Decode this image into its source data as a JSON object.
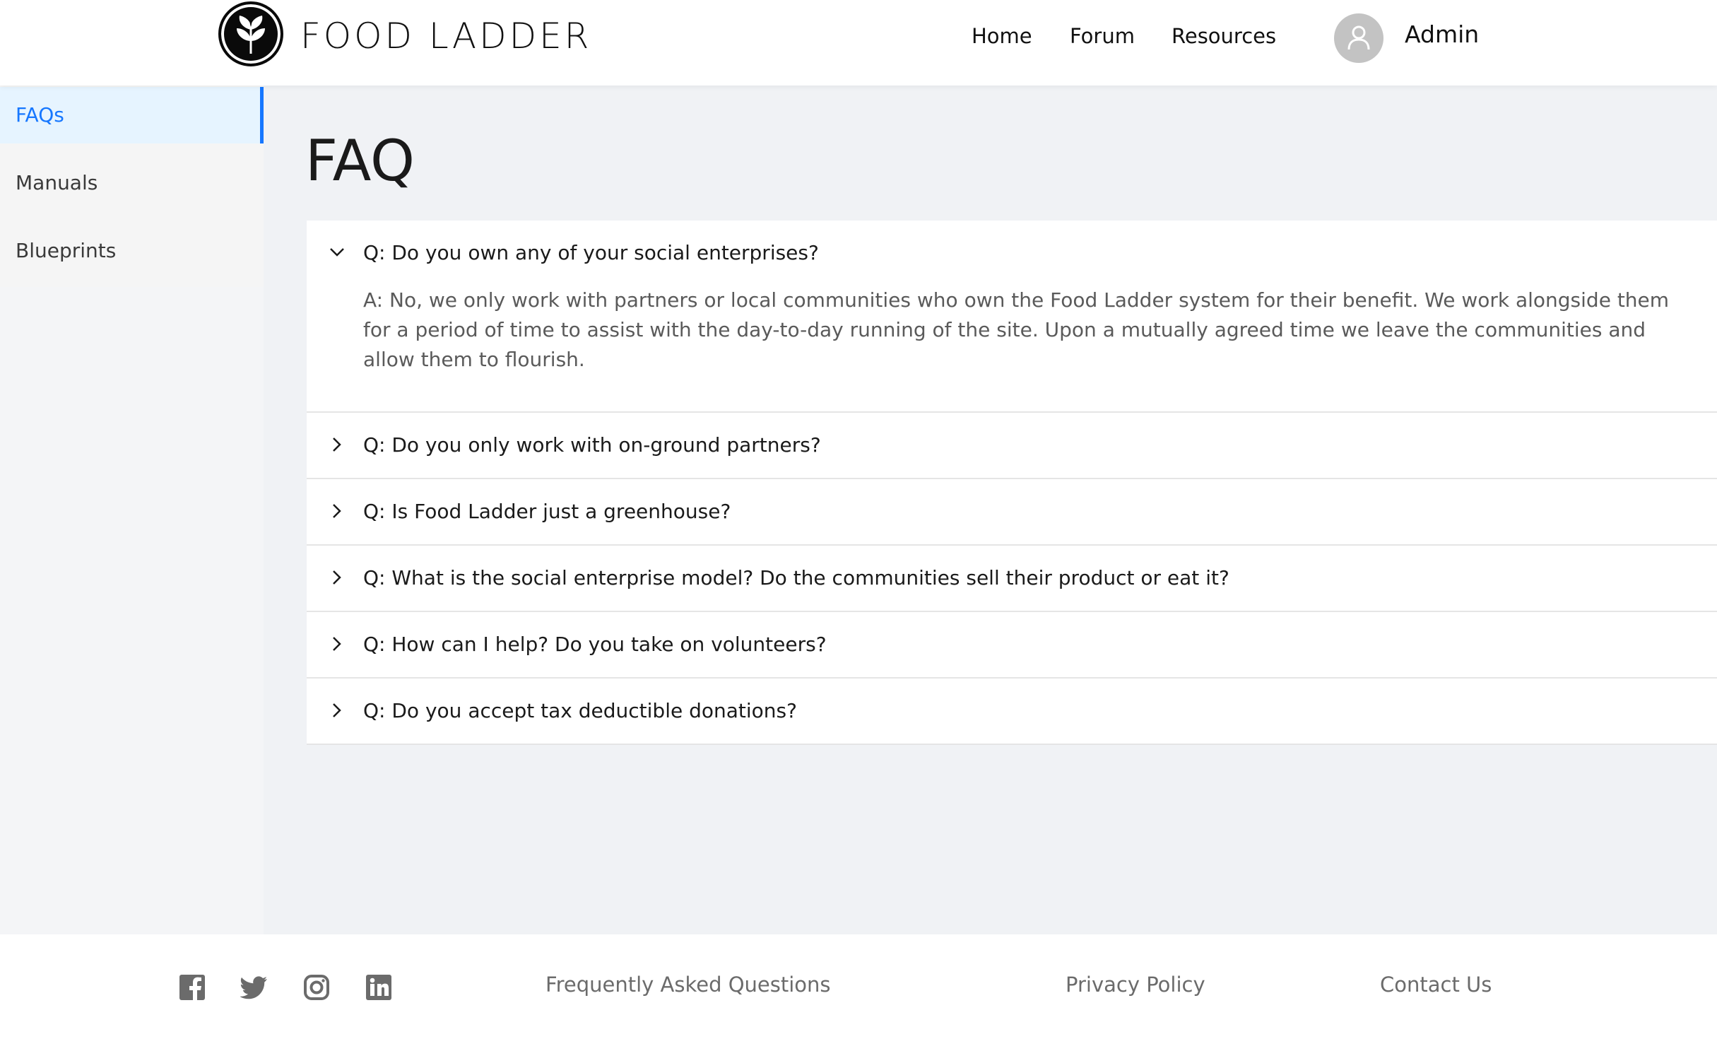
{
  "header": {
    "logo_text": "FOOD LADDER",
    "nav": [
      {
        "label": "Home"
      },
      {
        "label": "Forum"
      },
      {
        "label": "Resources"
      }
    ],
    "user_name": "Admin"
  },
  "sidebar": {
    "items": [
      {
        "label": "FAQs",
        "active": true
      },
      {
        "label": "Manuals"
      },
      {
        "label": "Blueprints"
      }
    ]
  },
  "main": {
    "title": "FAQ",
    "faqs": [
      {
        "question": "Q: Do you own any of your social enterprises?",
        "answer": "A: No, we only work with partners or local communities who own the Food Ladder system for their benefit. We work alongside them for a period of time to assist with the day-to-day running of the site. Upon a mutually agreed time we leave the communities and allow them to flourish.",
        "expanded": true
      },
      {
        "question": "Q: Do you only work with on-ground partners?",
        "expanded": false
      },
      {
        "question": "Q: Is Food Ladder just a greenhouse?",
        "expanded": false
      },
      {
        "question": "Q: What is the social enterprise model? Do the communities sell their product or eat it?",
        "expanded": false
      },
      {
        "question": "Q: How can I help? Do you take on volunteers?",
        "expanded": false
      },
      {
        "question": "Q: Do you accept tax deductible donations?",
        "expanded": false
      }
    ]
  },
  "footer": {
    "social_icons": [
      "facebook-icon",
      "twitter-icon",
      "instagram-icon",
      "linkedin-icon"
    ],
    "links": [
      {
        "label": "Frequently Asked Questions"
      },
      {
        "label": "Privacy Policy"
      },
      {
        "label": "Contact Us"
      }
    ]
  },
  "colors": {
    "accent": "#1677ff",
    "active_bg": "#e6f4ff",
    "page_bg": "#f0f2f5"
  }
}
